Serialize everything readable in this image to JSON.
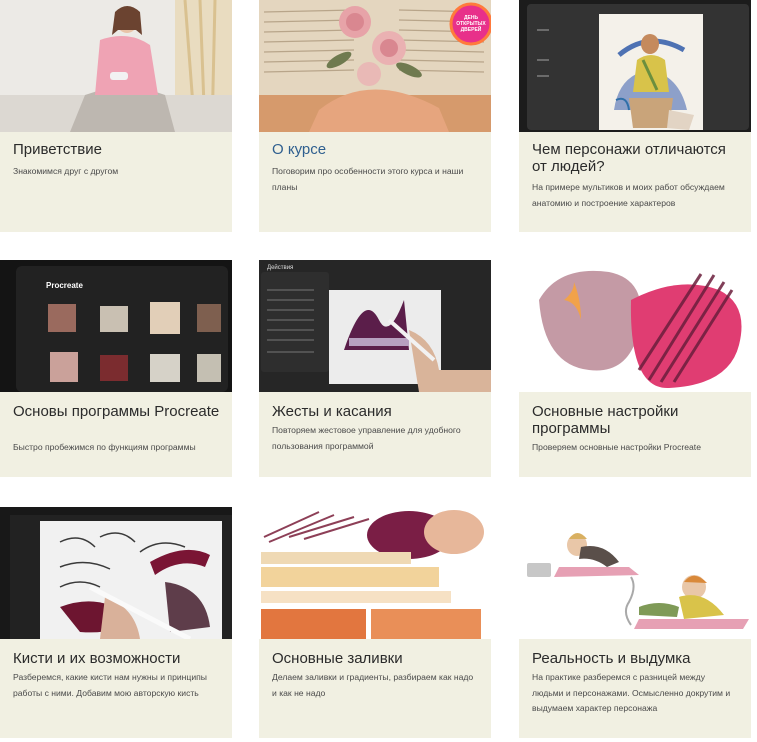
{
  "lessons": [
    {
      "title": "Приветствие",
      "desc": "Знакомимся друг с другом",
      "active": false
    },
    {
      "title": "О курсе",
      "desc": "Поговорим про особенности этого курса и наши планы",
      "active": true,
      "badge": "ДЕНЬ ОТКРЫТЫХ ДВЕРЕЙ"
    },
    {
      "title": "Чем персонажи отличаются от людей?",
      "desc": "На примере мультиков и моих работ обсуждаем анатомию и построение характеров",
      "active": false
    },
    {
      "title": "Основы программы Procreate",
      "desc": "Быстро пробежимся по функциям программы",
      "active": false,
      "screen_label": "Procreate"
    },
    {
      "title": "Жесты и касания",
      "desc": "Повторяем жестовое управление для удобного пользования программой",
      "active": false,
      "screen_label": "Действия"
    },
    {
      "title": "Основные настройки программы",
      "desc": "Проверяем основные настройки Procreate",
      "active": false
    },
    {
      "title": "Кисти и их возможности",
      "desc": "Разберемся, какие кисти нам нужны и принципы работы с ними. Добавим мою авторскую кисть",
      "active": false
    },
    {
      "title": "Основные заливки",
      "desc": "Делаем заливки и градиенты, разбираем как надо и как не надо",
      "active": false
    },
    {
      "title": "Реальность и выдумка",
      "desc": "На практике разберемся с разницей между людьми и персонажами. Осмысленно докрутим и выдумаем характер персонажа",
      "active": false
    }
  ]
}
